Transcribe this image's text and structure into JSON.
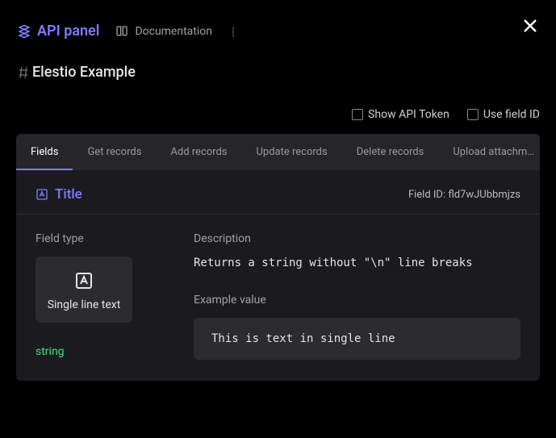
{
  "header": {
    "logo_text": "API panel",
    "doc_link": "Documentation"
  },
  "page_title": "Elestio Example",
  "options": {
    "show_token": "Show API Token",
    "use_field_id": "Use field ID"
  },
  "tabs": [
    {
      "label": "Fields",
      "active": true
    },
    {
      "label": "Get records"
    },
    {
      "label": "Add records"
    },
    {
      "label": "Update records"
    },
    {
      "label": "Delete records"
    },
    {
      "label": "Upload attachm…"
    }
  ],
  "field": {
    "title": "Title",
    "id_label": "Field ID: fld7wJUbbmjzs",
    "type_label": "Field type",
    "type_card": "Single line text",
    "type_value": "string",
    "desc_label": "Description",
    "desc_text": "Returns a string without \"\\n\" line breaks",
    "example_label": "Example value",
    "example_value": "This is text in single line"
  }
}
